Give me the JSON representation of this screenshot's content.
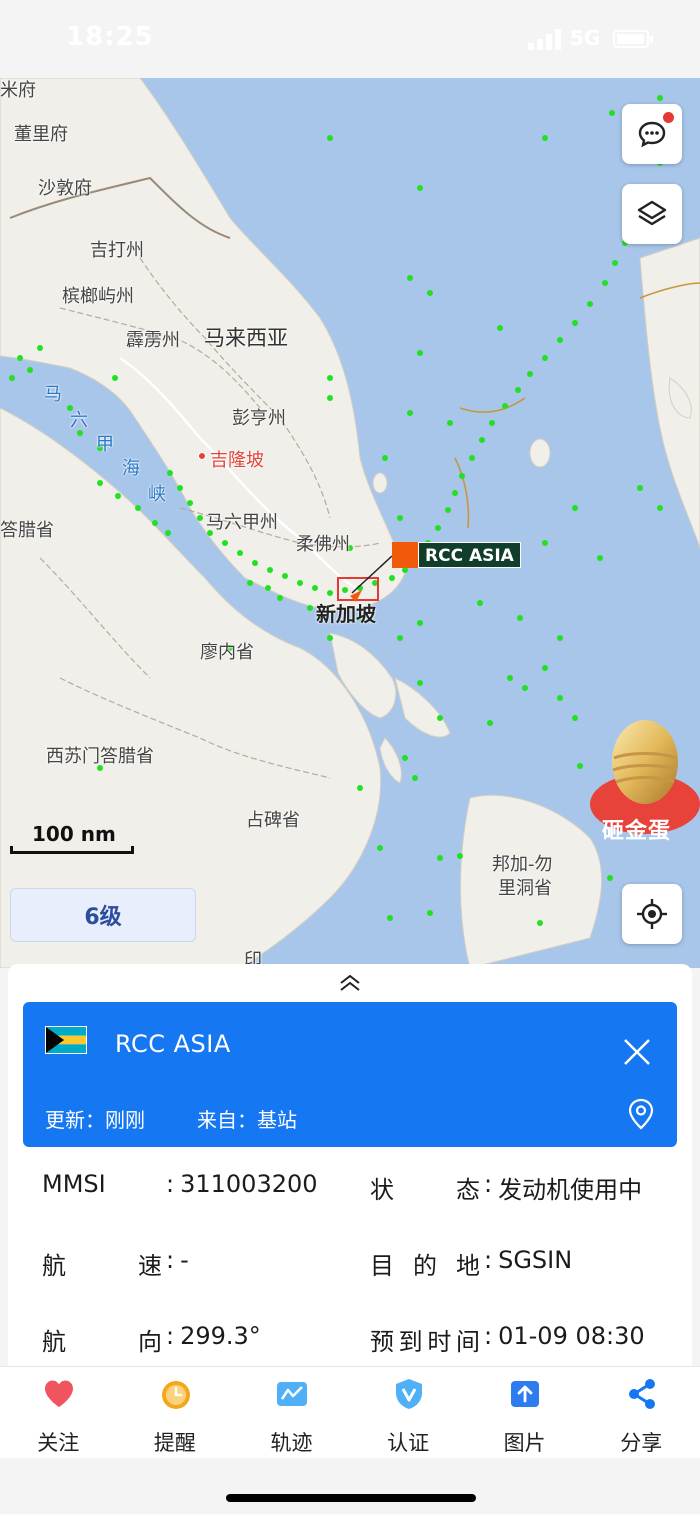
{
  "status_bar": {
    "time": "18:25",
    "network": "5G",
    "battery_level": 0.85
  },
  "map": {
    "places": {
      "p1": "米府",
      "p2": "董里府",
      "p3": "沙敦府",
      "p4": "吉打州",
      "p5": "槟榔屿州",
      "p6": "霹雳州",
      "p7": "马来西亚",
      "p8": "彭亨州",
      "p9": "吉隆坡",
      "p10": "马六甲州",
      "p11": "柔佛州",
      "p12": "新加坡",
      "p13": "答腊省",
      "p14": "廖内省",
      "p15": "西苏门答腊省",
      "p16": "占碑省",
      "p17": "邦加-勿",
      "p18": "里洞省",
      "p19": "印"
    },
    "strait_chars": [
      "马",
      "六",
      "甲",
      "海",
      "峡"
    ],
    "ship_label": "RCC ASIA",
    "scale": "100 nm",
    "zoom_level": "6级",
    "promo": "砸金蛋"
  },
  "panel": {
    "ship_name": "RCC ASIA",
    "update_label": "更新：",
    "update_value": "刚刚",
    "source_label": "来自：",
    "source_value": "基站",
    "rows": [
      {
        "lk": "MMSI",
        "lv": "311003200",
        "rk": "状态",
        "rv": "发动机使用中"
      },
      {
        "lk": "航速",
        "lv": "-",
        "rk": "目的地",
        "rv": "SGSIN"
      },
      {
        "lk": "航向",
        "lv": "299.3°",
        "rk": "预到时间",
        "rv": "01-09 08:30"
      }
    ]
  },
  "nav": {
    "follow": "关注",
    "remind": "提醒",
    "track": "轨迹",
    "verify": "认证",
    "photo": "图片",
    "share": "分享"
  },
  "colors": {
    "accent": "#1677f2",
    "ship_marker": "#f05a0a",
    "vessel_dots": "#22e022",
    "sea": "#a8c6ea",
    "land": "#f1efe9"
  }
}
